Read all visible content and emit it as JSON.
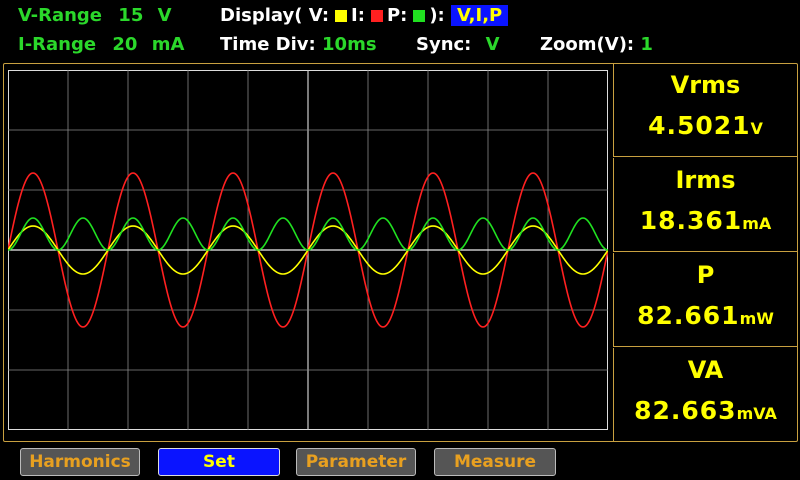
{
  "header": {
    "vrange_label": "V-Range",
    "vrange_value": "15",
    "vrange_unit": "V",
    "display_label": "Display( V:",
    "display_i": "I:",
    "display_p": "P:",
    "display_close": "):",
    "display_value": "V,I,P",
    "irange_label": "I-Range",
    "irange_value": "20",
    "irange_unit": "mA",
    "timediv_label": "Time  Div:",
    "timediv_value": "10ms",
    "sync_label": "Sync:",
    "sync_value": "V",
    "zoom_label": "Zoom(V):",
    "zoom_value": "1"
  },
  "colors": {
    "voltage_trace": "#ffff00",
    "current_trace": "#ff2020",
    "power_trace": "#20e020",
    "grid": "#888888",
    "frame": "#c8a040"
  },
  "measurements": [
    {
      "label": "Vrms",
      "value": "4.5021",
      "unit": "V"
    },
    {
      "label": "Irms",
      "value": "18.361",
      "unit": "mA"
    },
    {
      "label": "P",
      "value": "82.661",
      "unit": "mW"
    },
    {
      "label": "VA",
      "value": "82.663",
      "unit": "mVA"
    }
  ],
  "buttons": [
    {
      "label": "Harmonics",
      "active": false
    },
    {
      "label": "Set",
      "active": true
    },
    {
      "label": "Parameter",
      "active": false
    },
    {
      "label": "Measure",
      "active": false
    }
  ]
}
